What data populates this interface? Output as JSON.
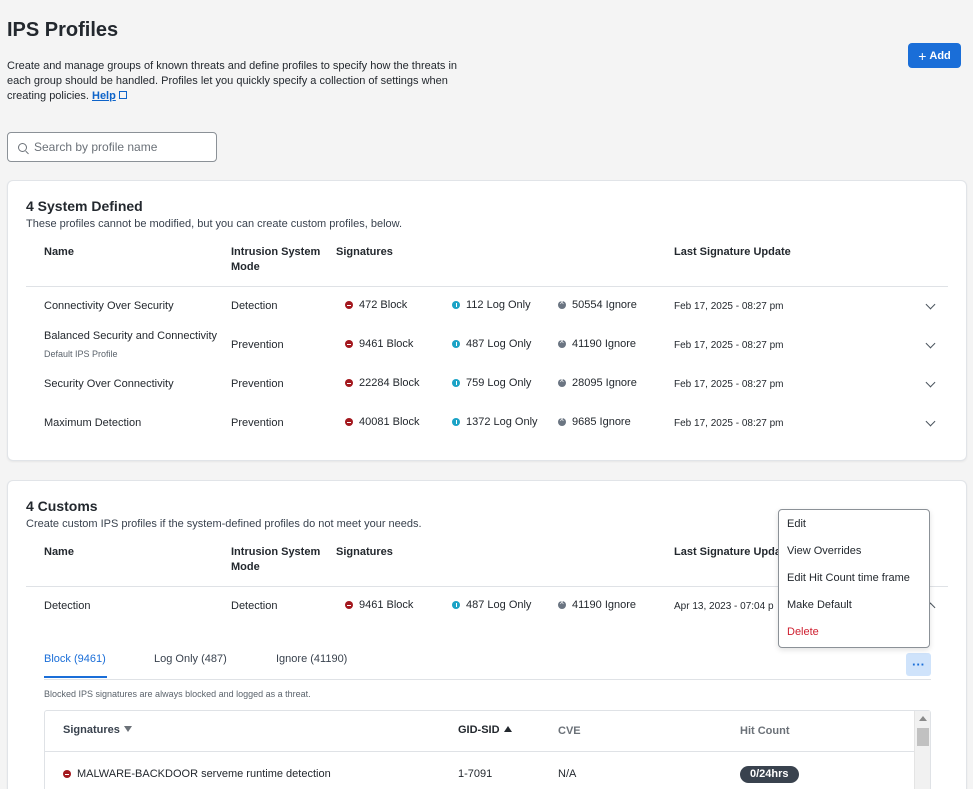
{
  "page": {
    "title": "IPS Profiles",
    "description": "Create and manage groups of known threats and define profiles to specify how the threats in each group should be handled. Profiles let you quickly specify a collection of settings when creating policies.",
    "help_label": "Help",
    "add_label": "Add",
    "search_placeholder": "Search by profile name"
  },
  "columns": {
    "name": "Name",
    "mode_line1": "Intrusion System",
    "mode_line2": "Mode",
    "signatures": "Signatures",
    "last_update": "Last Signature Update"
  },
  "system": {
    "title": "4 System Defined",
    "subtitle": "These profiles cannot be modified, but you can create custom profiles, below.",
    "rows": [
      {
        "name": "Connectivity Over Security",
        "sub": "",
        "mode": "Detection",
        "block": "472 Block",
        "log": "112 Log Only",
        "ignore": "50554 Ignore",
        "updated": "Feb 17, 2025 - 08:27 pm"
      },
      {
        "name": "Balanced Security and Connectivity",
        "sub": "Default IPS Profile",
        "mode": "Prevention",
        "block": "9461 Block",
        "log": "487 Log Only",
        "ignore": "41190 Ignore",
        "updated": "Feb 17, 2025 - 08:27 pm"
      },
      {
        "name": "Security Over Connectivity",
        "sub": "",
        "mode": "Prevention",
        "block": "22284 Block",
        "log": "759 Log Only",
        "ignore": "28095 Ignore",
        "updated": "Feb 17, 2025 - 08:27 pm"
      },
      {
        "name": "Maximum Detection",
        "sub": "",
        "mode": "Prevention",
        "block": "40081 Block",
        "log": "1372 Log Only",
        "ignore": "9685 Ignore",
        "updated": "Feb 17, 2025 - 08:27 pm"
      }
    ]
  },
  "customs": {
    "title": "4 Customs",
    "subtitle": "Create custom IPS profiles if the system-defined profiles do not meet your needs.",
    "last_update_truncated": "Last Signature Upda",
    "row": {
      "name": "Detection",
      "mode": "Detection",
      "block": "9461 Block",
      "log": "487 Log Only",
      "ignore": "41190 Ignore",
      "updated": "Apr 13, 2023 - 07:04 p"
    },
    "tabs": [
      "Block (9461)",
      "Log Only (487)",
      "Ignore (41190)"
    ],
    "more_label": "···",
    "note": "Blocked IPS signatures are always blocked and logged as a threat.",
    "sig_table": {
      "headers": {
        "signatures": "Signatures",
        "gid_sid": "GID-SID",
        "cve": "CVE",
        "hit_count": "Hit Count"
      },
      "rows": [
        {
          "signature": "MALWARE-BACKDOOR serveme runtime detection",
          "gid_sid": "1-7091",
          "cve": "N/A",
          "hit_count": "0/24hrs"
        }
      ]
    }
  },
  "menu": {
    "items": [
      "Edit",
      "View Overrides",
      "Edit Hit Count time frame",
      "Make Default",
      "Delete"
    ]
  },
  "colors": {
    "accent": "#1a6ed8",
    "block": "#a3181e",
    "log": "#1ba3c6",
    "ignore": "#6b7582",
    "danger": "#cf2030"
  }
}
